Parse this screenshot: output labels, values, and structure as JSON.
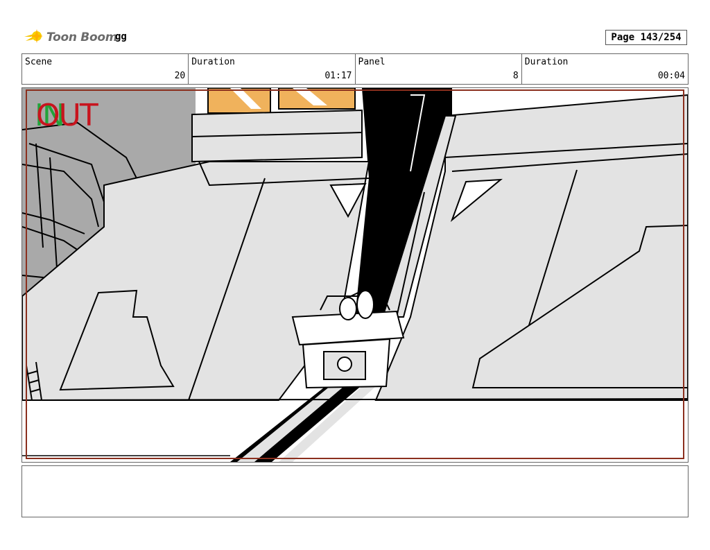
{
  "header": {
    "logo_text": "Toon Boom",
    "project_name": "gg",
    "page_label": "Page 143/254"
  },
  "info": {
    "scene_label": "Scene",
    "scene_value": "20",
    "scene_duration_label": "Duration",
    "scene_duration_value": "01:17",
    "panel_label": "Panel",
    "panel_value": "8",
    "panel_duration_label": "Duration",
    "panel_duration_value": "00:04"
  },
  "overlay": {
    "in_text": "IN",
    "out_text": "OUT",
    "in_color": "#22a33a",
    "out_color": "#c8141e"
  },
  "colors": {
    "frame_border": "#8b2f1e",
    "sky": "#f0b25c",
    "background_gray": "#a9a9a9",
    "wall": "#e3e3e3"
  },
  "notes": {
    "text": ""
  }
}
